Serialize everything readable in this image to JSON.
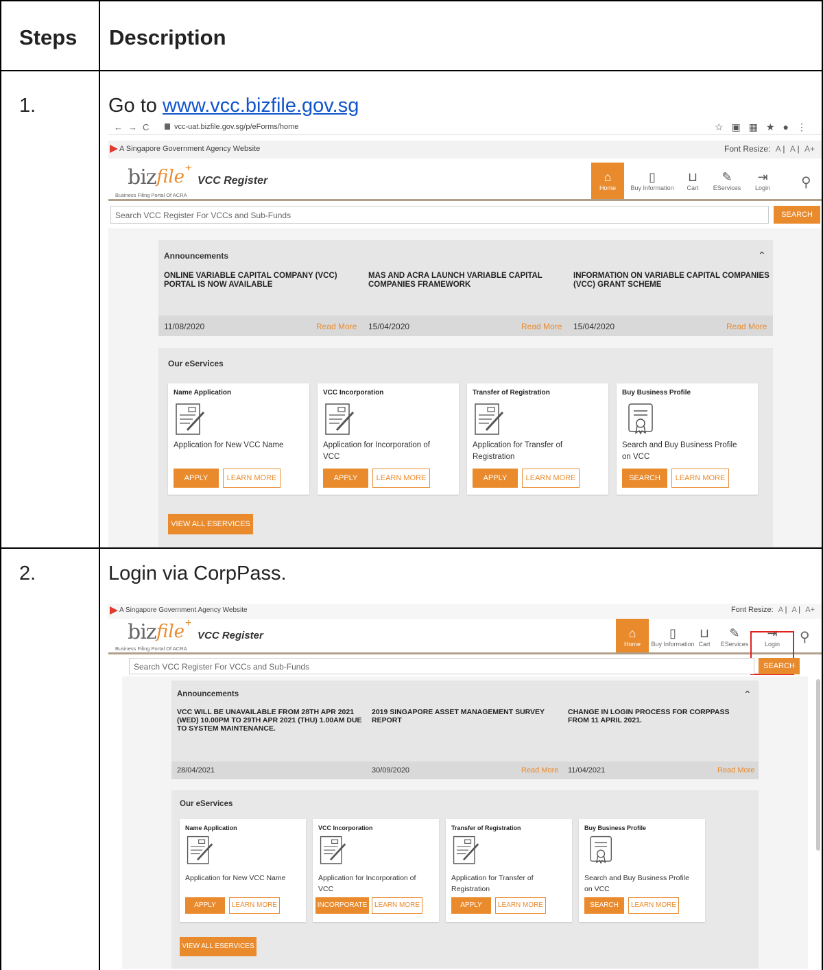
{
  "table": {
    "header_steps": "Steps",
    "header_description": "Description",
    "rows": [
      {
        "num": "1.",
        "text_prefix": "Go to ",
        "link": "www.vcc.bizfile.gov.sg"
      },
      {
        "num": "2.",
        "text": "Login via CorpPass."
      }
    ]
  },
  "browser": {
    "url": "vcc-uat.bizfile.gov.sg/p/eForms/home"
  },
  "site": {
    "gov_banner": "A Singapore Government Agency Website",
    "font_resize_label": "Font Resize:",
    "font_resize_options": [
      "A",
      "A",
      "A+"
    ],
    "logo_text": "bizfile",
    "logo_tagline": "Business Filing Portal Of ACRA",
    "title": "VCC Register",
    "nav": [
      "Home",
      "Buy Information",
      "Cart",
      "EServices",
      "Login"
    ],
    "search_placeholder": "Search VCC Register For VCCs and Sub-Funds",
    "search_button": "SEARCH",
    "announcements_title": "Announcements",
    "services_title": "Our eServices",
    "view_all": "VIEW ALL ESERVICES",
    "read_more": "Read More",
    "learn_more": "LEARN MORE"
  },
  "shot1": {
    "announcements": [
      {
        "headline": "ONLINE VARIABLE CAPITAL COMPANY (VCC) PORTAL IS NOW AVAILABLE",
        "date": "11/08/2020"
      },
      {
        "headline": "MAS AND ACRA LAUNCH VARIABLE CAPITAL COMPANIES FRAMEWORK",
        "date": "15/04/2020"
      },
      {
        "headline": "INFORMATION ON VARIABLE CAPITAL COMPANIES (VCC) GRANT SCHEME",
        "date": "15/04/2020"
      }
    ],
    "cards": [
      {
        "title": "Name Application",
        "desc": "Application for New VCC Name",
        "action": "APPLY"
      },
      {
        "title": "VCC Incorporation",
        "desc": "Application for Incorporation of VCC",
        "action": "APPLY"
      },
      {
        "title": "Transfer of Registration",
        "desc": "Application for Transfer of Registration",
        "action": "APPLY"
      },
      {
        "title": "Buy Business Profile",
        "desc": "Search and Buy Business Profile on VCC",
        "action": "SEARCH"
      }
    ]
  },
  "shot2": {
    "announcements": [
      {
        "headline": "VCC WILL BE UNAVAILABLE FROM 28TH APR 2021 (WED) 10.00PM TO 29TH APR 2021 (THU) 1.00AM DUE TO SYSTEM MAINTENANCE.",
        "date": "28/04/2021"
      },
      {
        "headline": "2019 SINGAPORE ASSET MANAGEMENT SURVEY REPORT",
        "date": "30/09/2020"
      },
      {
        "headline": "CHANGE IN LOGIN PROCESS FOR CORPPASS FROM 11 APRIL 2021.",
        "date": "11/04/2021"
      }
    ],
    "cards": [
      {
        "title": "Name Application",
        "desc": "Application for New VCC Name",
        "action": "APPLY"
      },
      {
        "title": "VCC Incorporation",
        "desc": "Application for Incorporation of VCC",
        "action": "INCORPORATE"
      },
      {
        "title": "Transfer of Registration",
        "desc": "Application for Transfer of Registration",
        "action": "APPLY"
      },
      {
        "title": "Buy Business Profile",
        "desc": "Search and Buy Business Profile on VCC",
        "action": "SEARCH"
      }
    ]
  },
  "colors": {
    "accent": "#e98a2d",
    "highlight": "#e02020",
    "link": "#1155cc"
  }
}
